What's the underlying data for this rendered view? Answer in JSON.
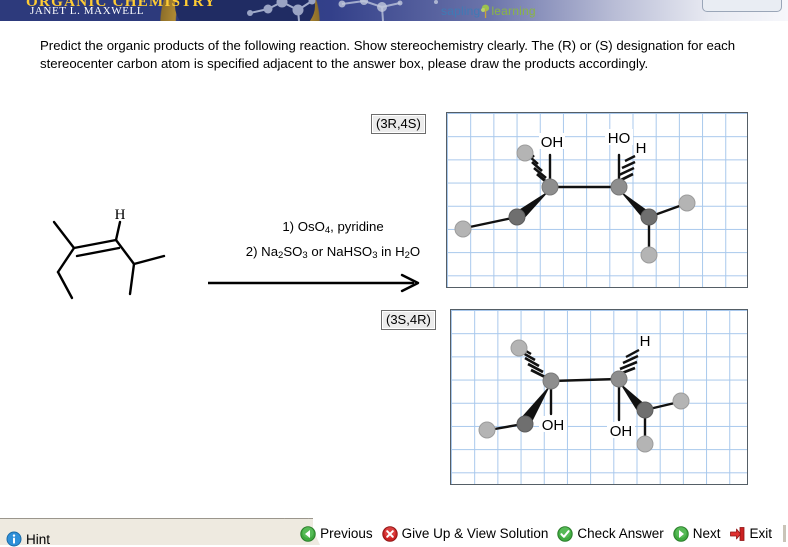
{
  "header": {
    "course_title": "ORGANIC CHEMISTRY",
    "author": "JANET L. MAXWELL",
    "logo_first": "sapling",
    "logo_second": "learning",
    "logo_tree_icon": "tree-icon",
    "molecule_decoration_icon": "molecule-decoration-icon",
    "colors": {
      "header_blue": "#2d3a7c",
      "gold_arc": "#b08a33",
      "title_gold": "#ffcc33",
      "logo_blue": "#3f7ab5",
      "logo_green": "#8ab545"
    }
  },
  "question": {
    "text": "Predict the organic products of the following reaction. Show stereochemistry clearly. The (R) or (S) designation for each stereocenter carbon atom is specified adjacent to the answer box, please draw the products accordingly."
  },
  "reaction": {
    "starting_material_name": "3,4-dimethyl-2-pentene-skeletal-structure",
    "starting_material_atom_label": "H",
    "reagent_line_1": "1) OsO4, pyridine",
    "reagent_line_2": "2) Na2SO3 or NaHSO3 in H2O",
    "arrow_icon": "reaction-arrow-icon"
  },
  "answers": [
    {
      "stereo_label": "(3R,4S)",
      "box_name": "answer-box-3r4s",
      "atom_labels": [
        "OH",
        "HO",
        "H"
      ],
      "structure_name": "diol-product-3R4S-structure"
    },
    {
      "stereo_label": "(3S,4R)",
      "box_name": "answer-box-3s4r",
      "atom_labels": [
        "OH",
        "OH",
        "H"
      ],
      "structure_name": "diol-product-3S4R-structure"
    }
  ],
  "toolbar": {
    "hint_label": "Hint",
    "hint_icon": "hint-info-icon",
    "buttons": [
      {
        "label": "Previous",
        "icon": "previous-arrow-icon",
        "color": "#3faa3f"
      },
      {
        "label": "Give Up & View Solution",
        "icon": "give-up-x-icon",
        "color": "#cc2222"
      },
      {
        "label": "Check Answer",
        "icon": "check-answer-icon",
        "color": "#3faa3f"
      },
      {
        "label": "Next",
        "icon": "next-arrow-icon",
        "color": "#3faa3f"
      },
      {
        "label": "Exit",
        "icon": "exit-arrow-icon",
        "color": "#cc2222"
      }
    ]
  }
}
